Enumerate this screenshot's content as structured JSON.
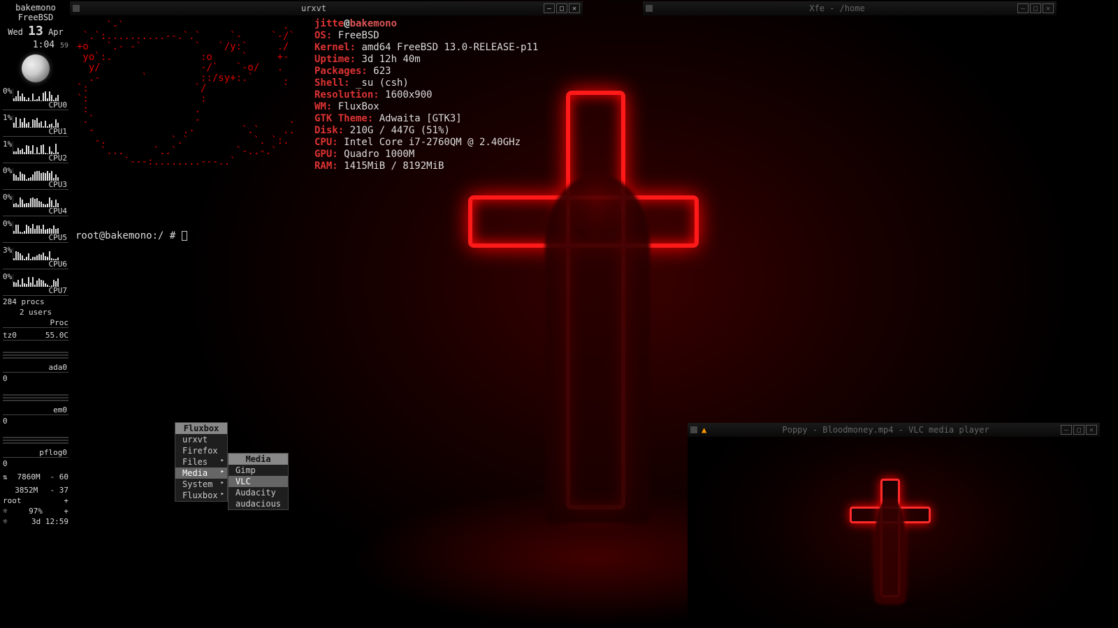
{
  "conky": {
    "host": "bakemono",
    "os": "FreeBSD",
    "day": "Wed",
    "daynum": "13",
    "month": "Apr",
    "time": "1:04",
    "seconds": "59",
    "cpus": [
      {
        "pct": "0%",
        "label": "CPU0"
      },
      {
        "pct": "1%",
        "label": "CPU1"
      },
      {
        "pct": "1%",
        "label": "CPU2"
      },
      {
        "pct": "0%",
        "label": "CPU3"
      },
      {
        "pct": "0%",
        "label": "CPU4"
      },
      {
        "pct": "0%",
        "label": "CPU5"
      },
      {
        "pct": "3%",
        "label": "CPU6"
      },
      {
        "pct": "0%",
        "label": "CPU7"
      }
    ],
    "procs": "284 procs",
    "users": "2 users",
    "proc_label": "Proc",
    "tz_label": "tz0",
    "tz_val": "55.0C",
    "devs": [
      "ada0",
      "em0",
      "pflog0"
    ],
    "dev_zero": "0",
    "mem1_sym": "⇅",
    "mem1": "7860M",
    "mem1_pct": "- 60",
    "mem2": "3852M",
    "mem2_pct": "- 37",
    "user": "root",
    "user_plus": "+",
    "bat_pct": "97%",
    "bat_plus": "+",
    "uptime_icon": "☼",
    "uptime": "3d 12:59"
  },
  "urxvt": {
    "title": "urxvt",
    "ascii": "     `-`                           .         \n `.`:..........--.`.`     `-     `-/`        \n+o   `.- -`         `   `/y:`     ./         \n yo`:.               :o     `     +-         \n  y/                 -/`   `-o/   .          \n  .-       `         ::/sy+:.`     .         \n`:                  `/             `         \n`:                   :                       \n :                  .                        \n .`                 -               .        \n  -               .-        `.`    ..        \n   -.           `.`           `. `:.         \n    `...     `..`          `-..-.`           \n        `---:........---..`                  ",
    "user": "jitte",
    "at": "@",
    "hostname": "bakemono",
    "lines": [
      {
        "k": "OS:",
        "v": " FreeBSD"
      },
      {
        "k": "Kernel:",
        "v": " amd64 FreeBSD 13.0-RELEASE-p11"
      },
      {
        "k": "Uptime:",
        "v": " 3d 12h 40m"
      },
      {
        "k": "Packages:",
        "v": " 623"
      },
      {
        "k": "Shell:",
        "v": " _su (csh)"
      },
      {
        "k": "Resolution:",
        "v": " 1600x900"
      },
      {
        "k": "WM:",
        "v": " FluxBox"
      },
      {
        "k": "GTK Theme:",
        "v": " Adwaita [GTK3]"
      },
      {
        "k": "Disk:",
        "v": " 210G / 447G (51%)"
      },
      {
        "k": "CPU:",
        "v": " Intel Core i7-2760QM @ 2.40GHz"
      },
      {
        "k": "GPU:",
        "v": " Quadro 1000M"
      },
      {
        "k": "RAM:",
        "v": " 1415MiB / 8192MiB"
      }
    ],
    "prompt": "root@bakemono:/ # "
  },
  "xfe": {
    "title": "Xfe - /home"
  },
  "vlc": {
    "title": "Poppy - Bloodmoney.mp4 - VLC media player",
    "cone": "▲"
  },
  "menu": {
    "title": "Fluxbox",
    "items": [
      {
        "label": "urxvt",
        "sub": false
      },
      {
        "label": "Firefox",
        "sub": false
      },
      {
        "label": "Files",
        "sub": true
      },
      {
        "label": "Media",
        "sub": true,
        "hover": true
      },
      {
        "label": "System",
        "sub": true
      },
      {
        "label": "Fluxbox",
        "sub": true
      }
    ],
    "submenu_title": "Media",
    "submenu": [
      {
        "label": "Gimp"
      },
      {
        "label": "VLC",
        "hover": true
      },
      {
        "label": "Audacity"
      },
      {
        "label": "audacious"
      }
    ]
  },
  "winbtns": {
    "min": "–",
    "max": "□",
    "close": "✕"
  }
}
